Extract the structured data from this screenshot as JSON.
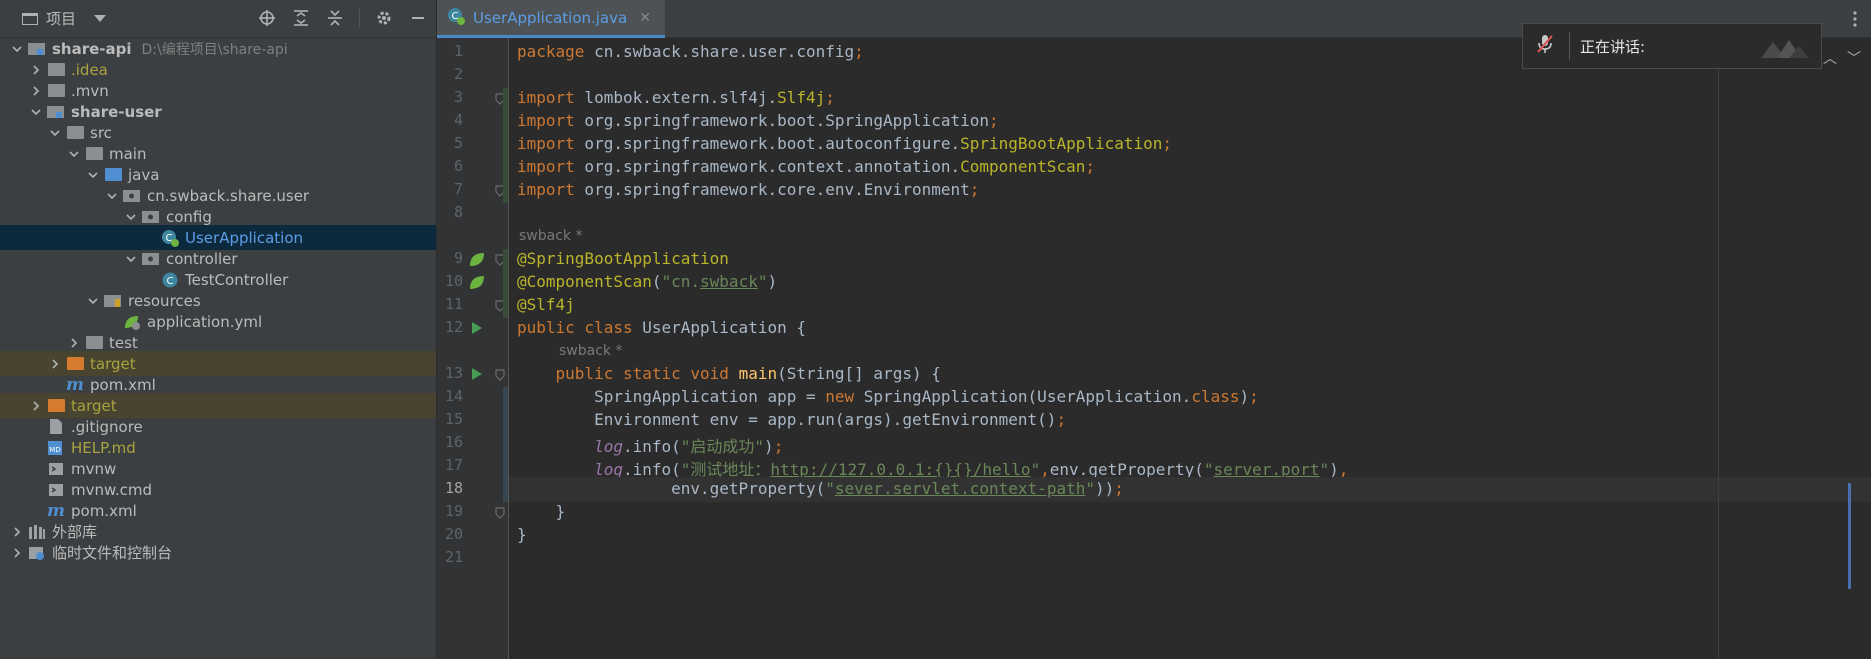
{
  "project_panel": {
    "title": "项目",
    "tree": [
      {
        "label": "share-api",
        "path": "D:\\编程项目\\share-api",
        "depth": 0,
        "expanded": true,
        "bold": true,
        "icon": "module-folder-icon"
      },
      {
        "label": ".idea",
        "depth": 1,
        "expanded": false,
        "icon": "folder-icon",
        "style": "yellow"
      },
      {
        "label": ".mvn",
        "depth": 1,
        "expanded": false,
        "icon": "folder-icon"
      },
      {
        "label": "share-user",
        "depth": 1,
        "expanded": true,
        "bold": true,
        "icon": "module-folder-icon"
      },
      {
        "label": "src",
        "depth": 2,
        "expanded": true,
        "icon": "folder-icon"
      },
      {
        "label": "main",
        "depth": 3,
        "expanded": true,
        "icon": "folder-icon"
      },
      {
        "label": "java",
        "depth": 4,
        "expanded": true,
        "icon": "source-folder-icon"
      },
      {
        "label": "cn.swback.share.user",
        "depth": 5,
        "expanded": true,
        "icon": "package-icon"
      },
      {
        "label": "config",
        "depth": 6,
        "expanded": true,
        "icon": "package-icon"
      },
      {
        "label": "UserApplication",
        "depth": 7,
        "leaf": true,
        "icon": "spring-boot-class-icon",
        "selected": true
      },
      {
        "label": "controller",
        "depth": 6,
        "expanded": true,
        "icon": "package-icon"
      },
      {
        "label": "TestController",
        "depth": 7,
        "leaf": true,
        "icon": "class-icon"
      },
      {
        "label": "resources",
        "depth": 4,
        "expanded": true,
        "icon": "resources-folder-icon"
      },
      {
        "label": "application.yml",
        "depth": 5,
        "leaf": true,
        "icon": "yaml-config-icon"
      },
      {
        "label": "test",
        "depth": 3,
        "expanded": false,
        "icon": "folder-icon"
      },
      {
        "label": "target",
        "depth": 2,
        "expanded": false,
        "icon": "excluded-folder-icon",
        "excluded": true
      },
      {
        "label": "pom.xml",
        "depth": 2,
        "leaf": true,
        "icon": "maven-icon"
      },
      {
        "label": "target",
        "depth": 1,
        "expanded": false,
        "icon": "excluded-folder-icon",
        "excluded": true
      },
      {
        "label": ".gitignore",
        "depth": 1,
        "leaf": true,
        "icon": "file-icon"
      },
      {
        "label": "HELP.md",
        "depth": 1,
        "leaf": true,
        "icon": "markdown-icon",
        "style": "yellow"
      },
      {
        "label": "mvnw",
        "depth": 1,
        "leaf": true,
        "icon": "script-icon"
      },
      {
        "label": "mvnw.cmd",
        "depth": 1,
        "leaf": true,
        "icon": "script-icon"
      },
      {
        "label": "pom.xml",
        "depth": 1,
        "leaf": true,
        "icon": "maven-icon"
      },
      {
        "label": "外部库",
        "depth": 0,
        "expanded": false,
        "icon": "library-icon"
      },
      {
        "label": "临时文件和控制台",
        "depth": 0,
        "expanded": false,
        "icon": "scratch-icon"
      }
    ]
  },
  "editor": {
    "tab_label": "UserApplication.java",
    "current_line": "18",
    "lines": [
      {
        "n": "1",
        "html": "<span class='kw'>package</span> cn.swback.share.user.config<span class='kw'>;</span>"
      },
      {
        "n": "2",
        "html": ""
      },
      {
        "n": "3",
        "html": "<span class='kw'>import</span> lombok.extern.slf4j.<span class='ann'>Slf4j</span><span class='kw'>;</span>"
      },
      {
        "n": "4",
        "html": "<span class='kw'>import</span> org.springframework.boot.SpringApplication<span class='kw'>;</span>"
      },
      {
        "n": "5",
        "html": "<span class='kw'>import</span> org.springframework.boot.autoconfigure.<span class='ann'>SpringBootApplication</span><span class='kw'>;</span>"
      },
      {
        "n": "6",
        "html": "<span class='kw'>import</span> org.springframework.context.annotation.<span class='ann'>ComponentScan</span><span class='kw'>;</span>"
      },
      {
        "n": "7",
        "html": "<span class='kw'>import</span> org.springframework.core.env.Environment<span class='kw'>;</span>"
      },
      {
        "n": "8",
        "html": ""
      },
      {
        "n": "9",
        "html": "<span class='ann'>@SpringBootApplication</span>"
      },
      {
        "n": "10",
        "html": "<span class='ann'>@ComponentScan</span>(<span class='str'>\"cn.<span class='ulg'>swback</span>\"</span>)"
      },
      {
        "n": "11",
        "html": "<span class='ann'>@Slf4j</span>"
      },
      {
        "n": "12",
        "html": "<span class='kw'>public class</span> UserApplication {"
      },
      {
        "n": "13",
        "html": "    <span class='kw'>public static void</span> <span class='fn'>main</span>(String[] args) {"
      },
      {
        "n": "14",
        "html": "        SpringApplication app = <span class='kw'>new</span> SpringApplication(UserApplication.<span class='kw'>class</span>)<span class='kw'>;</span>"
      },
      {
        "n": "15",
        "html": "        Environment env = app.run(args).getEnvironment()<span class='kw'>;</span>"
      },
      {
        "n": "16",
        "html": "        <span class='fld'>log</span>.info(<span class='str'>\"启动成功\"</span>)<span class='kw'>;</span>"
      },
      {
        "n": "17",
        "html": "        <span class='fld'>log</span>.info(<span class='str'>\"测试地址：<span class='ul'>http://127.0.0.1:{}{}/hello</span>\"</span><span class='kw'>,</span>env.getProperty(<span class='str'>\"<span class='ul'>server.port</span>\"</span>)<span class='kw'>,</span>"
      },
      {
        "n": "18",
        "html": "                env.getProperty(<span class='str'>\"<span class='ul'>sever.servlet.context-path</span>\"</span>))<span class='kw'>;</span>"
      },
      {
        "n": "19",
        "html": "    }"
      },
      {
        "n": "20",
        "html": "}"
      },
      {
        "n": "21",
        "html": ""
      }
    ],
    "author_hint_1": "swback *",
    "author_hint_2": "swback *"
  },
  "speaking_overlay": {
    "label": "正在讲话:"
  },
  "colors": {
    "keyword": "#cc7832",
    "annotation": "#bbb529",
    "string": "#6a8759",
    "method": "#ffc66d",
    "field": "#9876aa",
    "selection": "#0d293e",
    "tab_accent": "#4a88c7"
  }
}
